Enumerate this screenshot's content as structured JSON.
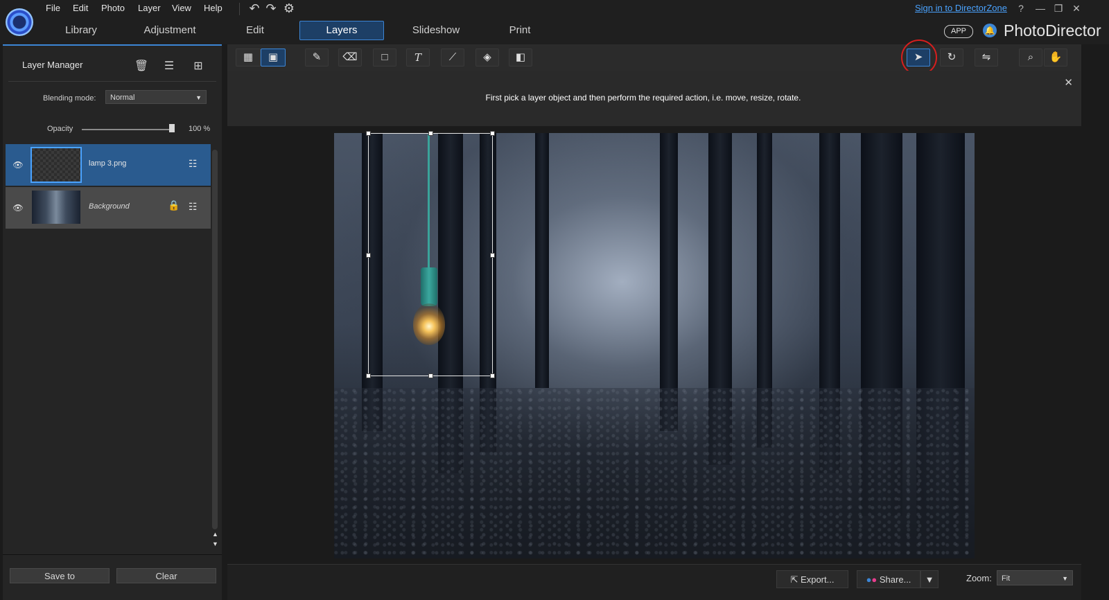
{
  "menu": {
    "items": [
      "File",
      "Edit",
      "Photo",
      "Layer",
      "View",
      "Help"
    ]
  },
  "quick_icons": {
    "undo": "undo-icon",
    "redo": "redo-icon",
    "settings": "gear-icon"
  },
  "modes": {
    "tabs": [
      "Library",
      "Adjustment",
      "Edit",
      "Layers",
      "Slideshow",
      "Print"
    ],
    "active": "Layers"
  },
  "header": {
    "signin_text": "Sign in to DirectorZone",
    "help_label": "?",
    "app_badge": "APP",
    "brand": "PhotoDirector",
    "window_controls": [
      "—",
      "❐",
      "✕"
    ]
  },
  "layer_panel": {
    "title": "Layer Manager",
    "blending_label": "Blending mode:",
    "blending_value": "Normal",
    "opacity_label": "Opacity",
    "opacity_value": "100 %",
    "opacity_percent": 100,
    "layers": [
      {
        "name": "lamp 3.png",
        "selected": true,
        "locked": false
      },
      {
        "name": "Background",
        "selected": false,
        "locked": true
      }
    ],
    "buttons": {
      "save": "Save to",
      "clear": "Clear"
    }
  },
  "toolbar": {
    "tools": [
      "object-mode",
      "image-mode",
      "pencil",
      "eraser",
      "rectangle",
      "text",
      "brush",
      "fill",
      "gradient",
      "select-move",
      "rotate",
      "flip",
      "zoom",
      "pan"
    ],
    "active": [
      "image-mode",
      "select-move"
    ]
  },
  "hint": {
    "text": "First pick a layer object and then perform the required action, i.e. move, resize, rotate."
  },
  "bottom": {
    "export_label": "Export...",
    "share_label": "Share...",
    "zoom_label": "Zoom:",
    "zoom_value": "Fit"
  },
  "colors": {
    "accent": "#3c86d6",
    "highlight_circle": "#d81e1e",
    "link": "#4aa3ff"
  }
}
